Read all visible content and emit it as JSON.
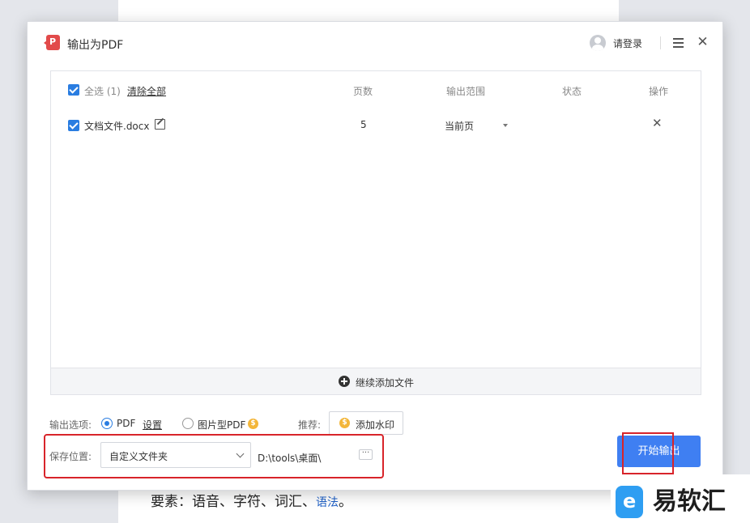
{
  "document": {
    "body_text": "要素：语音、字符、词汇、",
    "link_text": "语法",
    "end_text": "。"
  },
  "dialog": {
    "title": "输出为PDF",
    "app_icon_glyph": "P",
    "login_label": "请登录",
    "menu_icon": "hamburger-menu-icon",
    "close_glyph": "✕"
  },
  "file_table": {
    "select_all_label": "全选 (1)",
    "clear_all_label": "清除全部",
    "columns": [
      "页数",
      "输出范围",
      "状态",
      "操作"
    ],
    "rows": [
      {
        "name": "文档文件.docx",
        "pages": "5",
        "range": "当前页",
        "status": "",
        "action_glyph": "✕"
      }
    ],
    "add_more_label": "继续添加文件"
  },
  "options": {
    "label": "输出选项:",
    "pdf_label": "PDF",
    "settings_label": "设置",
    "image_pdf_label": "图片型PDF",
    "selected": "PDF",
    "recommend_label": "推荐:",
    "watermark_label": "添加水印",
    "coin_glyph": "$"
  },
  "save": {
    "label": "保存位置:",
    "folder_value": "自定义文件夹",
    "path_value": "D:\\tools\\桌面\\",
    "more_glyph": "···"
  },
  "start_label": "开始输出",
  "brand": {
    "logo_glyph": "e",
    "name": "易软汇"
  },
  "colors": {
    "accent": "#3f7ff2",
    "checkbox": "#2a7de1",
    "highlight_frame": "#d8242a",
    "coin": "#f3b63a",
    "brand_blue": "#2e9ef2"
  }
}
